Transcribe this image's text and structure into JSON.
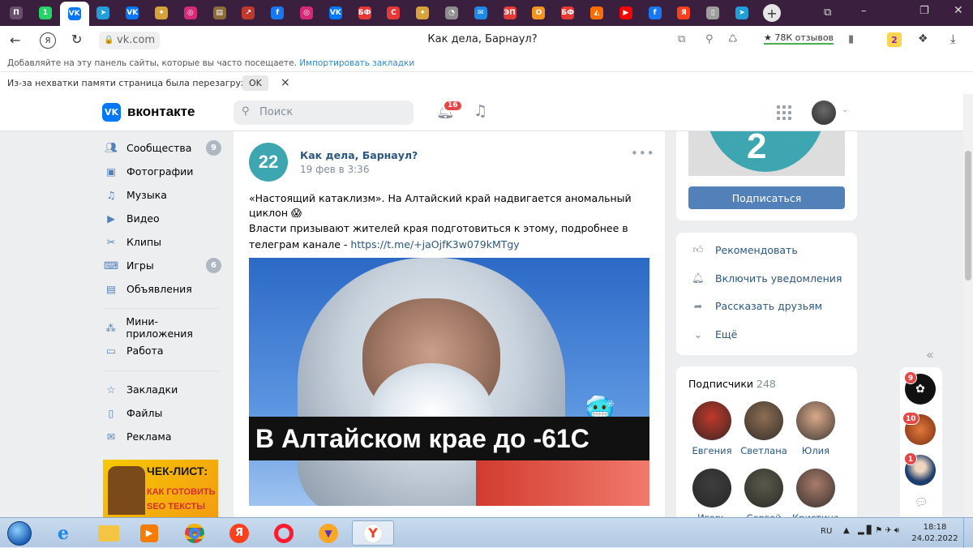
{
  "browser": {
    "tabs": [
      {
        "label": "П",
        "bg": "#6b4f6f"
      },
      {
        "label": "1",
        "bg": "#25d366"
      },
      {
        "label": "VK",
        "bg": "#0077ff",
        "active": true
      },
      {
        "label": "➤",
        "bg": "#229ed9"
      },
      {
        "label": "VK",
        "bg": "#0077ff"
      },
      {
        "label": "✦",
        "bg": "#d6a33a"
      },
      {
        "label": "◎",
        "bg": "#d62976"
      },
      {
        "label": "▤",
        "bg": "#8a6d3b"
      },
      {
        "label": "↗",
        "bg": "#c0392b"
      },
      {
        "label": "f",
        "bg": "#1877f2"
      },
      {
        "label": "◎",
        "bg": "#d62976"
      },
      {
        "label": "VK",
        "bg": "#0077ff"
      },
      {
        "label": "БФ",
        "bg": "#e53935"
      },
      {
        "label": "С",
        "bg": "#e53935"
      },
      {
        "label": "✦",
        "bg": "#d6a33a"
      },
      {
        "label": "◔",
        "bg": "#8d8d8d"
      },
      {
        "label": "✉",
        "bg": "#1e88e5"
      },
      {
        "label": "ЭП",
        "bg": "#e53935"
      },
      {
        "label": "О",
        "bg": "#f7931e"
      },
      {
        "label": "БФ",
        "bg": "#e53935"
      },
      {
        "label": "◭",
        "bg": "#ff6d00"
      },
      {
        "label": "▶",
        "bg": "#ff0000"
      },
      {
        "label": "f",
        "bg": "#1877f2"
      },
      {
        "label": "Я",
        "bg": "#fc3f1d"
      },
      {
        "label": "▯",
        "bg": "#9e9e9e"
      },
      {
        "label": "➤",
        "bg": "#229ed9"
      }
    ],
    "new_tab": "+",
    "url": "vk.com",
    "page_title": "Как дела, Барнаул?",
    "reviews": "★ 78К отзывов",
    "bookmarks_hint": "Добавляйте на эту панель сайты, которые вы часто посещаете.",
    "bookmarks_import": "Импортировать закладки",
    "info_text": "Из-за нехватки памяти страница была перезагружена",
    "info_ok": "OK",
    "info_close": "×"
  },
  "vk": {
    "logo_text": "вконтакте",
    "search_placeholder": "Поиск",
    "notif_count": "16",
    "nav": [
      {
        "label": "Сообщества",
        "icon": "people-icon",
        "badge": "9"
      },
      {
        "label": "Фотографии",
        "icon": "photo-icon",
        "badge": ""
      },
      {
        "label": "Музыка",
        "icon": "music-icon",
        "badge": ""
      },
      {
        "label": "Видео",
        "icon": "video-icon",
        "badge": ""
      },
      {
        "label": "Клипы",
        "icon": "clips-icon",
        "badge": ""
      },
      {
        "label": "Игры",
        "icon": "gamepad-icon",
        "badge": "6"
      },
      {
        "label": "Объявления",
        "icon": "ads-icon",
        "badge": ""
      },
      {
        "label": "Мини-приложения",
        "icon": "apps-icon",
        "badge": ""
      },
      {
        "label": "Работа",
        "icon": "briefcase-icon",
        "badge": ""
      },
      {
        "label": "Закладки",
        "icon": "star-icon",
        "badge": ""
      },
      {
        "label": "Файлы",
        "icon": "file-icon",
        "badge": ""
      },
      {
        "label": "Реклама",
        "icon": "megaphone-icon",
        "badge": ""
      }
    ],
    "ad_line1": "ЧЕК-ЛИСТ:",
    "ad_line2": "КАК ГОТОВИТЬ",
    "ad_line3": "SEO ТЕКСТЫ",
    "post": {
      "group_name": "Как дела, Барнаул?",
      "avatar_text": "22",
      "date": "19 фев в 3:36",
      "text1": "«Настоящий катаклизм». На Алтайский край надвигается аномальный циклон 😱",
      "text2": "Власти призывают жителей края подготовиться к этому, подробнее в телеграм канале - ",
      "link": "https://t.me/+jaOjfK3w079kMTgy",
      "image_caption": "В Алтайском крае до -61С",
      "emoji": "🥶"
    },
    "right": {
      "subscribe": "Подписаться",
      "actions": [
        {
          "label": "Рекомендовать",
          "icon": "thumb-up-icon"
        },
        {
          "label": "Включить уведомления",
          "icon": "bell-icon"
        },
        {
          "label": "Рассказать друзьям",
          "icon": "share-icon"
        },
        {
          "label": "Ещё",
          "icon": "chevron-down-icon"
        }
      ],
      "subscribers_title": "Подписчики",
      "subscribers_count": "248",
      "subscribers": [
        {
          "name": "Евгения",
          "color": "#c0392b"
        },
        {
          "name": "Светлана",
          "color": "#8e6e53"
        },
        {
          "name": "Юлия",
          "color": "#d9a98a"
        },
        {
          "name": "Игорь",
          "color": "#3e3e3e"
        },
        {
          "name": "Сергей",
          "color": "#5a5a4a"
        },
        {
          "name": "Кристина",
          "color": "#a97c6b"
        }
      ]
    },
    "chat_badges": [
      "9",
      "10",
      "1"
    ]
  },
  "taskbar": {
    "lang": "RU",
    "time": "18:18",
    "date": "24.02.2022"
  }
}
